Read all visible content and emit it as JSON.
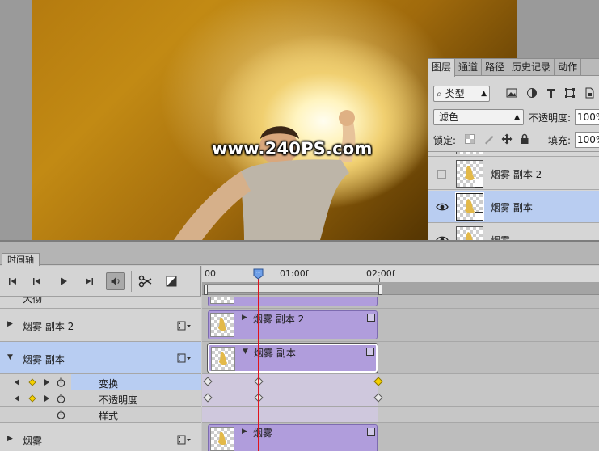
{
  "canvas": {
    "watermark": "www.240PS.com"
  },
  "layers_panel": {
    "tabs": [
      {
        "label": "图层",
        "active": true
      },
      {
        "label": "通道",
        "active": false
      },
      {
        "label": "路径",
        "active": false
      },
      {
        "label": "历史记录",
        "active": false
      },
      {
        "label": "动作",
        "active": false
      }
    ],
    "filter": {
      "label": "类型"
    },
    "blend_mode": "滤色",
    "opacity_label": "不透明度:",
    "opacity_value": "100%",
    "lock_label": "锁定:",
    "fill_label": "填充:",
    "fill_value": "100%",
    "layers": [
      {
        "name": "烟雾 副本 2",
        "visible": false,
        "selected": false
      },
      {
        "name": "烟雾 副本",
        "visible": true,
        "selected": true
      },
      {
        "name": "烟雾",
        "visible": true,
        "selected": false
      }
    ]
  },
  "timeline": {
    "tab_label": "时间轴",
    "ruler": {
      "labels": [
        "00",
        "01:00f",
        "02:00f"
      ]
    },
    "tracks": [
      {
        "name": "大彻",
        "clip_name": "",
        "expanded": false
      },
      {
        "name": "烟雾 副本 2",
        "clip_name": "烟雾 副本 2",
        "expanded": false
      },
      {
        "name": "烟雾 副本",
        "clip_name": "烟雾 副本",
        "expanded": true,
        "selected": true
      },
      {
        "name": "烟雾",
        "clip_name": "烟雾",
        "expanded": false
      }
    ],
    "properties": [
      {
        "label": "变换",
        "has_keyframes": true
      },
      {
        "label": "不透明度",
        "has_keyframes": true
      },
      {
        "label": "样式",
        "has_keyframes": false
      }
    ],
    "colors": {
      "clip": "#b09ddc",
      "selected_row": "#b8cdf2",
      "playhead": "#e0141c",
      "keyframe_selected": "#f5d000"
    }
  }
}
